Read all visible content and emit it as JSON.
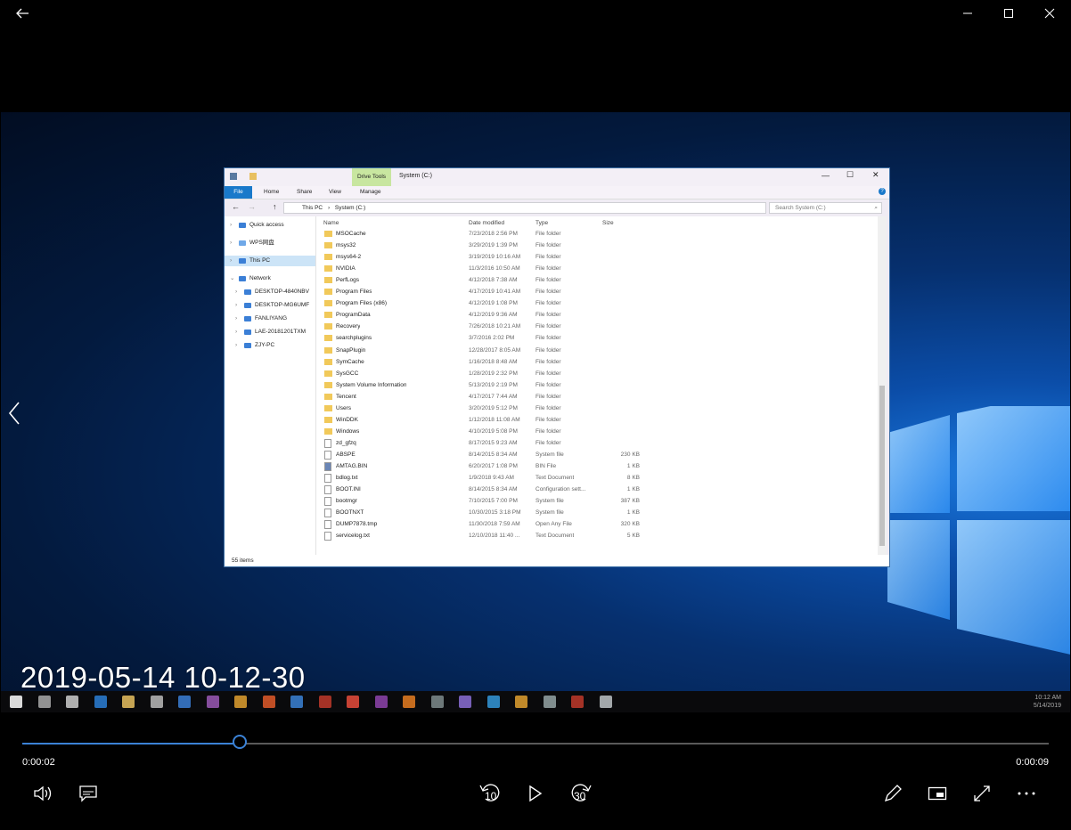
{
  "window": {
    "back_icon": "back-arrow-icon",
    "minimize_icon": "minimize-icon",
    "maximize_icon": "maximize-icon",
    "close_icon": "close-icon"
  },
  "video": {
    "timestamp_overlay": "2019-05-14 10-12-30",
    "taskbar_clock_time": "10:12 AM",
    "taskbar_clock_date": "5/14/2019"
  },
  "explorer": {
    "title": "System (C:)",
    "contextual_tab": "Drive Tools",
    "ribbon_tabs": [
      "File",
      "Home",
      "Share",
      "View",
      "Manage"
    ],
    "breadcrumb": [
      "This PC",
      "System (C:)"
    ],
    "search_placeholder": "Search System (C:)",
    "nav_items": [
      {
        "label": "Quick access",
        "icon": "star-icon"
      },
      {
        "label": "WPS网盘",
        "icon": "cloud-icon"
      },
      {
        "label": "This PC",
        "icon": "computer-icon",
        "selected": true
      },
      {
        "label": "Network",
        "icon": "network-icon"
      },
      {
        "label": "DESKTOP-4840NBV",
        "icon": "computer-icon"
      },
      {
        "label": "DESKTOP-MG6UMF",
        "icon": "computer-icon"
      },
      {
        "label": "FANLIYANG",
        "icon": "computer-icon"
      },
      {
        "label": "LAE-20181201TXM",
        "icon": "computer-icon"
      },
      {
        "label": "ZJY-PC",
        "icon": "computer-icon"
      }
    ],
    "columns": [
      "Name",
      "Date modified",
      "Type",
      "Size"
    ],
    "files": [
      {
        "name": "MSOCache",
        "date": "7/23/2018 2:56 PM",
        "type": "File folder",
        "size": "",
        "kind": "folder"
      },
      {
        "name": "msys32",
        "date": "3/29/2019 1:39 PM",
        "type": "File folder",
        "size": "",
        "kind": "folder"
      },
      {
        "name": "msys64-2",
        "date": "3/19/2019 10:16 AM",
        "type": "File folder",
        "size": "",
        "kind": "folder"
      },
      {
        "name": "NVIDIA",
        "date": "11/3/2016 10:50 AM",
        "type": "File folder",
        "size": "",
        "kind": "folder"
      },
      {
        "name": "PerfLogs",
        "date": "4/12/2018 7:38 AM",
        "type": "File folder",
        "size": "",
        "kind": "folder"
      },
      {
        "name": "Program Files",
        "date": "4/17/2019 10:41 AM",
        "type": "File folder",
        "size": "",
        "kind": "folder"
      },
      {
        "name": "Program Files (x86)",
        "date": "4/12/2019 1:08 PM",
        "type": "File folder",
        "size": "",
        "kind": "folder"
      },
      {
        "name": "ProgramData",
        "date": "4/12/2019 9:36 AM",
        "type": "File folder",
        "size": "",
        "kind": "folder"
      },
      {
        "name": "Recovery",
        "date": "7/26/2018 10:21 AM",
        "type": "File folder",
        "size": "",
        "kind": "folder"
      },
      {
        "name": "searchplugins",
        "date": "3/7/2016 2:02 PM",
        "type": "File folder",
        "size": "",
        "kind": "folder"
      },
      {
        "name": "SnapPlugin",
        "date": "12/28/2017 8:05 AM",
        "type": "File folder",
        "size": "",
        "kind": "folder"
      },
      {
        "name": "SymCache",
        "date": "1/16/2018 8:48 AM",
        "type": "File folder",
        "size": "",
        "kind": "folder"
      },
      {
        "name": "SysGCC",
        "date": "1/28/2019 2:32 PM",
        "type": "File folder",
        "size": "",
        "kind": "folder"
      },
      {
        "name": "System Volume Information",
        "date": "5/13/2019 2:19 PM",
        "type": "File folder",
        "size": "",
        "kind": "folder"
      },
      {
        "name": "Tencent",
        "date": "4/17/2017 7:44 AM",
        "type": "File folder",
        "size": "",
        "kind": "folder"
      },
      {
        "name": "Users",
        "date": "3/20/2019 5:12 PM",
        "type": "File folder",
        "size": "",
        "kind": "folder"
      },
      {
        "name": "WinDDK",
        "date": "1/12/2018 11:08 AM",
        "type": "File folder",
        "size": "",
        "kind": "folder"
      },
      {
        "name": "Windows",
        "date": "4/10/2019 5:08 PM",
        "type": "File folder",
        "size": "",
        "kind": "folder"
      },
      {
        "name": "zd_gfzq",
        "date": "8/17/2015 9:23 AM",
        "type": "File folder",
        "size": "",
        "kind": "file"
      },
      {
        "name": "ABSPE",
        "date": "8/14/2015 8:34 AM",
        "type": "System file",
        "size": "230 KB",
        "kind": "file"
      },
      {
        "name": "AMTAG.BIN",
        "date": "6/20/2017 1:08 PM",
        "type": "BIN File",
        "size": "1 KB",
        "kind": "bin"
      },
      {
        "name": "bdlog.txt",
        "date": "1/9/2018 9:43 AM",
        "type": "Text Document",
        "size": "8 KB",
        "kind": "file"
      },
      {
        "name": "BOOT.INI",
        "date": "8/14/2015 8:34 AM",
        "type": "Configuration sett...",
        "size": "1 KB",
        "kind": "ini"
      },
      {
        "name": "bootmgr",
        "date": "7/10/2015 7:00 PM",
        "type": "System file",
        "size": "387 KB",
        "kind": "file"
      },
      {
        "name": "BOOTNXT",
        "date": "10/30/2015 3:18 PM",
        "type": "System file",
        "size": "1 KB",
        "kind": "file"
      },
      {
        "name": "DUMP7878.tmp",
        "date": "11/30/2018 7:59 AM",
        "type": "Open Any File",
        "size": "320 KB",
        "kind": "file"
      },
      {
        "name": "servicelog.txt",
        "date": "12/10/2018 11:40 ...",
        "type": "Text Document",
        "size": "5 KB",
        "kind": "file"
      }
    ],
    "status": "55 items"
  },
  "player": {
    "current_time": "0:00:02",
    "total_time": "0:00:09",
    "progress": 0.212,
    "skip_back_label": "10",
    "skip_forward_label": "30",
    "accent": "#3b82d6"
  }
}
